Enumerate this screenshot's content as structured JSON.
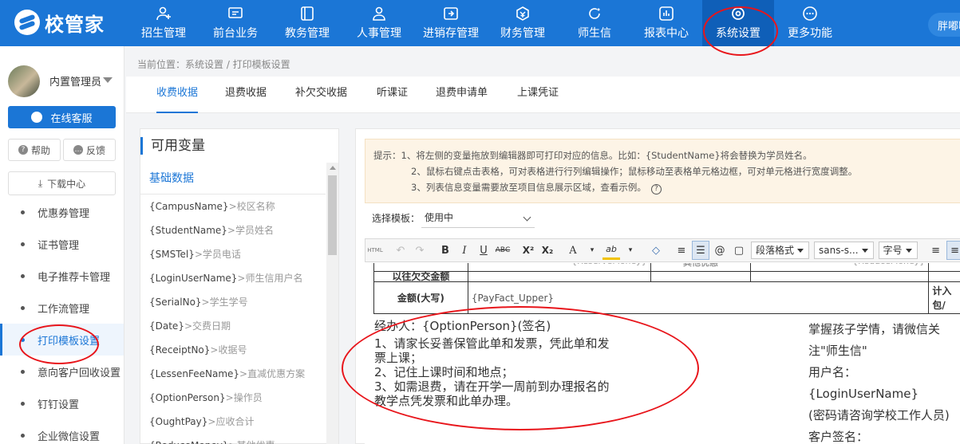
{
  "app": {
    "brand": "校管家"
  },
  "nav": [
    {
      "label": "招生管理",
      "icon": "user-add-icon"
    },
    {
      "label": "前台业务",
      "icon": "desk-icon"
    },
    {
      "label": "教务管理",
      "icon": "book-icon"
    },
    {
      "label": "人事管理",
      "icon": "person-icon"
    },
    {
      "label": "进销存管理",
      "icon": "inventory-icon"
    },
    {
      "label": "财务管理",
      "icon": "finance-icon"
    },
    {
      "label": "师生信",
      "icon": "chat-icon"
    },
    {
      "label": "报表中心",
      "icon": "report-icon"
    },
    {
      "label": "系统设置",
      "icon": "settings-icon",
      "active": true
    },
    {
      "label": "更多功能",
      "icon": "more-icon"
    }
  ],
  "user_chip": "胖嘟嘟",
  "sidebar": {
    "admin_name": "内置管理员",
    "online_service": "在线客服",
    "help": "帮助",
    "feedback": "反馈",
    "download": "下载中心",
    "menu": [
      {
        "label": "优惠券管理"
      },
      {
        "label": "证书管理"
      },
      {
        "label": "电子推荐卡管理"
      },
      {
        "label": "工作流管理"
      },
      {
        "label": "打印模板设置",
        "active": true
      },
      {
        "label": "意向客户回收设置"
      },
      {
        "label": "钉钉设置"
      },
      {
        "label": "企业微信设置"
      }
    ]
  },
  "breadcrumb": "当前位置：系统设置 / 打印模板设置",
  "tabs": [
    "收费收据",
    "退费收据",
    "补欠交收据",
    "听课证",
    "退费申请单",
    "上课凭证"
  ],
  "variables": {
    "title": "可用变量",
    "section": "基础数据",
    "items": [
      {
        "name": "{CampusName}",
        "desc": ">校区名称"
      },
      {
        "name": "{StudentName}",
        "desc": ">学员姓名"
      },
      {
        "name": "{SMSTel}",
        "desc": ">学员电话"
      },
      {
        "name": "{LoginUserName}",
        "desc": ">师生信用户名"
      },
      {
        "name": "{SerialNo}",
        "desc": ">学生学号"
      },
      {
        "name": "{Date}",
        "desc": ">交费日期"
      },
      {
        "name": "{ReceiptNo}",
        "desc": ">收据号"
      },
      {
        "name": "{LessenFeeName}",
        "desc": ">直减优惠方案"
      },
      {
        "name": "{OptionPerson}",
        "desc": ">操作员"
      },
      {
        "name": "{OughtPay}",
        "desc": ">应收合计"
      },
      {
        "name": "{ReduceMoney}",
        "desc": ">其他优惠"
      }
    ]
  },
  "tips": {
    "line1": "提示：1、将左侧的变量拖放到编辑器即可打印对应的信息。比如：{StudentName}将会替换为学员姓名。",
    "line2": "2、鼠标右键点击表格，可对表格进行行列编辑操作；鼠标移动至表格单元格边框，可对单元格进行宽度调整。",
    "line3": "3、列表信息变量需要放至项目信息展示区域，查看示例。",
    "help_glyph": "?"
  },
  "template_select": {
    "label": "选择模板：",
    "value": "使用中"
  },
  "toolbar": {
    "html": "HTML",
    "undo": "↶",
    "redo": "↷",
    "bold": "B",
    "italic": "I",
    "underline": "U",
    "strike": "ABC",
    "sup": "X²",
    "sub": "X₂",
    "font_color": "A",
    "highlight": "ab",
    "clear": "◇",
    "ol": "≡",
    "ul": "☰",
    "paragraph": "段落格式",
    "font_family": "sans-s...",
    "font_size": "字号",
    "align_left": "≡",
    "align_center": "≡"
  },
  "document": {
    "row0": {
      "left_var": "{ReserveMoney}",
      "mid_label": "其他优惠",
      "right_var": "{ReduceMoney}"
    },
    "row1": {
      "label": "以往欠交金额"
    },
    "row2": {
      "label": "金额(大写)",
      "value": "{PayFact_Upper}",
      "right_1": "计入",
      "right_2": "包/"
    },
    "signature": "经办人：{OptionPerson}(签名)",
    "notes": [
      "1、请家长妥善保管此单和发票，凭此单和发",
      "票上课；",
      "2、记住上课时间和地点；",
      "3、如需退费，请在开学一周前到办理报名的",
      "教学点凭发票和此单办理。"
    ],
    "right_lines": [
      "掌握孩子学情，请微信关",
      "注\"师生信\"",
      "用户名：",
      "{LoginUserName}",
      "(密码请咨询学校工作人员)",
      "客户签名："
    ]
  }
}
